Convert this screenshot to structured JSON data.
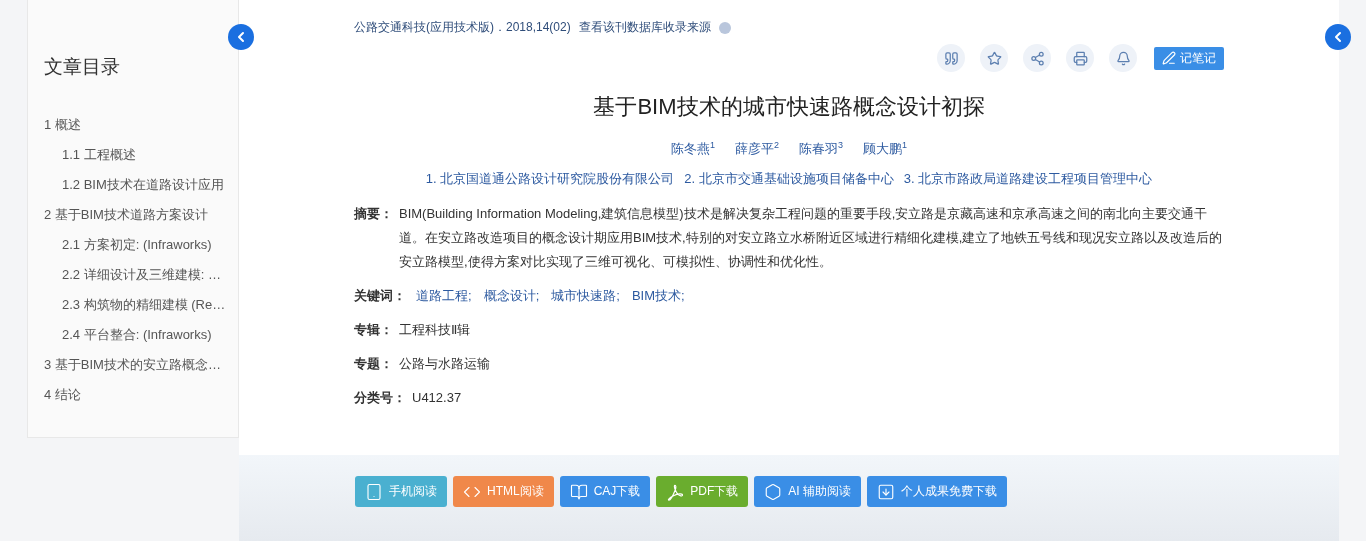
{
  "toc": {
    "title": "文章目录",
    "items": [
      {
        "label": "1 概述",
        "children": [
          {
            "label": "1.1 工程概述"
          },
          {
            "label": "1.2 BIM技术在道路设计应用"
          }
        ]
      },
      {
        "label": "2 基于BIM技术道路方案设计",
        "children": [
          {
            "label": "2.1 方案初定: (Infraworks)"
          },
          {
            "label": "2.2 详细设计及三维建模: …"
          },
          {
            "label": "2.3 构筑物的精细建模 (Re…"
          },
          {
            "label": "2.4 平台整合: (Infraworks)"
          }
        ]
      },
      {
        "label": "3 基于BIM技术的安立路概念…"
      },
      {
        "label": "4 结论"
      }
    ]
  },
  "source": {
    "journal": "公路交通科技(应用技术版)．2018,14(02)",
    "link": "查看该刊数据库收录来源"
  },
  "toolbar": {
    "note_button": "记笔记"
  },
  "article": {
    "title": "基于BIM技术的城市快速路概念设计初探",
    "authors": [
      "陈冬燕$^{1}$",
      "薛彦平$^{2}$",
      "陈春羽$^{3}$",
      "顾大鹏$^{1}$"
    ],
    "affiliations": [
      "1. 北京国道通公路设计研究院股份有限公司",
      "2. 北京市交通基础设施项目储备中心",
      "3. 北京市路政局道路建设工程项目管理中心"
    ],
    "fields": [
      {
        "kind": "text",
        "label": "摘要：",
        "value": "BIM(Building Information Modeling,建筑信息模型)技术是解决复杂工程问题的重要手段,安立路是京藏高速和京承高速之间的南北向主要交通干道。在安立路改造项目的概念设计期应用BIM技术,特别的对安立路立水桥附近区域进行精细化建模,建立了地铁五号线和现况安立路以及改造后的安立路模型,使得方案对比实现了三维可视化、可模拟性、协调性和优化性。"
      },
      {
        "kind": "links",
        "label": "关键词：",
        "values": [
          "道路工程;",
          "概念设计;",
          "城市快速路;",
          "BIM技术;"
        ]
      },
      {
        "kind": "text",
        "label": "专辑：",
        "value": "工程科技Ⅱ辑"
      },
      {
        "kind": "text",
        "label": "专题：",
        "value": "公路与水路运输"
      },
      {
        "kind": "text",
        "label": "分类号：",
        "value": "U412.37"
      }
    ]
  },
  "actions": [
    {
      "label": "手机阅读",
      "color": "#4ab0d0"
    },
    {
      "label": "HTML阅读",
      "color": "#f0884a"
    },
    {
      "label": "CAJ下载",
      "color": "#3a8ee6"
    },
    {
      "label": "PDF下载",
      "color": "#6aad2e"
    },
    {
      "label": "AI 辅助阅读",
      "color": "#3a8ee6"
    },
    {
      "label": "个人成果免费下载",
      "color": "#3a8ee6"
    }
  ]
}
